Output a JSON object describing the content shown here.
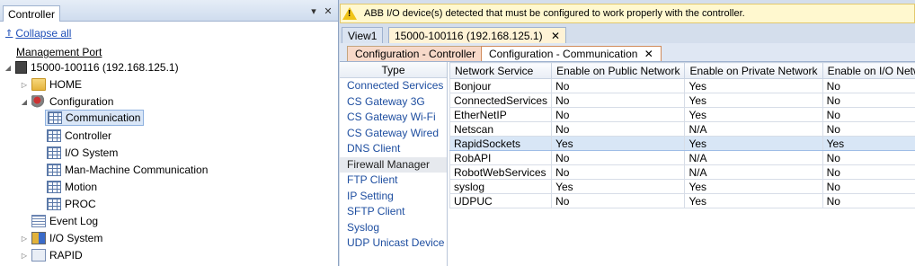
{
  "left": {
    "title": "Controller",
    "collapse_all": "Collapse all",
    "management_port": "Management Port",
    "tree": {
      "controller": "15000-100116 (192.168.125.1)",
      "home": "HOME",
      "configuration": "Configuration",
      "communication": "Communication",
      "controller_node": "Controller",
      "io_system_cfg": "I/O System",
      "mmc": "Man-Machine Communication",
      "motion": "Motion",
      "proc": "PROC",
      "event_log": "Event Log",
      "io_system": "I/O System",
      "rapid": "RAPID"
    }
  },
  "warning": "ABB I/O device(s) detected that must be configured to work properly with the controller.",
  "doc_tabs": [
    "View1",
    "15000-100116 (192.168.125.1)"
  ],
  "sub_tabs": [
    "Configuration - Controller",
    "Configuration - Communication"
  ],
  "type_list": {
    "header": "Type",
    "items": [
      "Connected Services",
      "CS Gateway 3G",
      "CS Gateway Wi-Fi",
      "CS Gateway Wired",
      "DNS Client",
      "Firewall Manager",
      "FTP Client",
      "IP Setting",
      "SFTP Client",
      "Syslog",
      "UDP Unicast Device"
    ]
  },
  "grid": {
    "columns": [
      "Network Service",
      "Enable on Public Network",
      "Enable on Private Network",
      "Enable on I/O Network"
    ],
    "rows": [
      [
        "Bonjour",
        "No",
        "Yes",
        "No"
      ],
      [
        "ConnectedServices",
        "No",
        "Yes",
        "No"
      ],
      [
        "EtherNetIP",
        "No",
        "Yes",
        "No"
      ],
      [
        "Netscan",
        "No",
        "N/A",
        "No"
      ],
      [
        "RapidSockets",
        "Yes",
        "Yes",
        "Yes"
      ],
      [
        "RobAPI",
        "No",
        "N/A",
        "No"
      ],
      [
        "RobotWebServices",
        "No",
        "N/A",
        "No"
      ],
      [
        "syslog",
        "Yes",
        "Yes",
        "No"
      ],
      [
        "UDPUC",
        "No",
        "Yes",
        "No"
      ]
    ]
  }
}
